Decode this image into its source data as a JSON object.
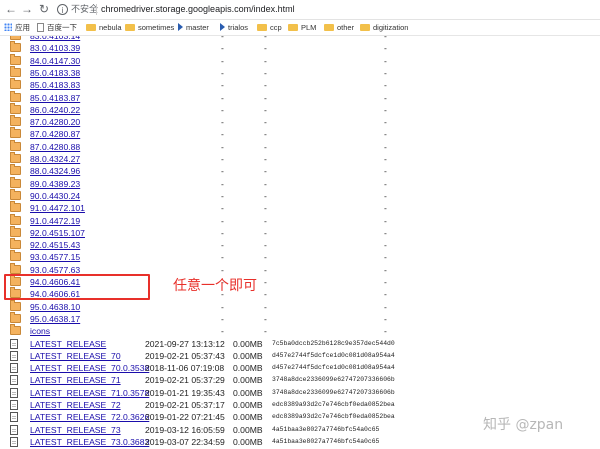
{
  "browser": {
    "insecure_label": "不安全",
    "url": "chromedriver.storage.googleapis.com/index.html"
  },
  "bookmarks": [
    {
      "label": "应用",
      "icon": "apps-grid-icon"
    },
    {
      "label": "百度一下",
      "icon": "page-icon"
    },
    {
      "label": "nebula",
      "icon": "folder-icon"
    },
    {
      "label": "sometimes",
      "icon": "folder-icon"
    },
    {
      "label": "master",
      "icon": "jenkins-icon"
    },
    {
      "label": "trialos",
      "icon": "jenkins-icon"
    },
    {
      "label": "ccp",
      "icon": "folder-icon"
    },
    {
      "label": "PLM",
      "icon": "folder-icon"
    },
    {
      "label": "other",
      "icon": "folder-icon"
    },
    {
      "label": "digitization",
      "icon": "folder-icon"
    }
  ],
  "directories": [
    "83.0.4103.14",
    "83.0.4103.39",
    "84.0.4147.30",
    "85.0.4183.38",
    "85.0.4183.83",
    "85.0.4183.87",
    "86.0.4240.22",
    "87.0.4280.20",
    "87.0.4280.87",
    "87.0.4280.88",
    "88.0.4324.27",
    "88.0.4324.96",
    "89.0.4389.23",
    "90.0.4430.24",
    "91.0.4472.101",
    "91.0.4472.19",
    "92.0.4515.107",
    "92.0.4515.43",
    "93.0.4577.15",
    "93.0.4577.63",
    "94.0.4606.41",
    "94.0.4606.61",
    "95.0.4638.10",
    "95.0.4638.17",
    "icons"
  ],
  "dash": "-",
  "files": [
    {
      "name": "LATEST_RELEASE",
      "date": "2021-09-27 13:13:12",
      "size": "0.00MB",
      "etag": "7c5ba0dccb252b6128c9e357dec544d0"
    },
    {
      "name": "LATEST_RELEASE_70",
      "date": "2019-02-21 05:37:43",
      "size": "0.00MB",
      "etag": "d457e2744f5dcfce1d0c081d08a954a4"
    },
    {
      "name": "LATEST_RELEASE_70.0.3538",
      "date": "2018-11-06 07:19:08",
      "size": "0.00MB",
      "etag": "d457e2744f5dcfce1d0c081d08a954a4"
    },
    {
      "name": "LATEST_RELEASE_71",
      "date": "2019-02-21 05:37:29",
      "size": "0.00MB",
      "etag": "3748a8dce2336099e62747207336606b"
    },
    {
      "name": "LATEST_RELEASE_71.0.3578",
      "date": "2019-01-21 19:35:43",
      "size": "0.00MB",
      "etag": "3748a8dce2336099e62747207336606b"
    },
    {
      "name": "LATEST_RELEASE_72",
      "date": "2019-02-21 05:37:17",
      "size": "0.00MB",
      "etag": "edc8389a93d2c7e746cbf0eda0852bea"
    },
    {
      "name": "LATEST_RELEASE_72.0.3626",
      "date": "2019-01-22 07:21:45",
      "size": "0.00MB",
      "etag": "edc8389a93d2c7e746cbf0eda0852bea"
    },
    {
      "name": "LATEST_RELEASE_73",
      "date": "2019-03-12 16:05:59",
      "size": "0.00MB",
      "etag": "4a51baa3e8027a7746bfc54a0c65"
    },
    {
      "name": "LATEST_RELEASE_73.0.3683",
      "date": "2019-03-07 22:34:59",
      "size": "0.00MB",
      "etag": "4a51baa3e8027a7746bfc54a0c65"
    }
  ],
  "annotation": "任意一个即可",
  "watermark": "知乎 @zpan",
  "colors": {
    "link": "#1a0dab",
    "annotation": "#e8302a",
    "folder": "#f4b25e"
  }
}
